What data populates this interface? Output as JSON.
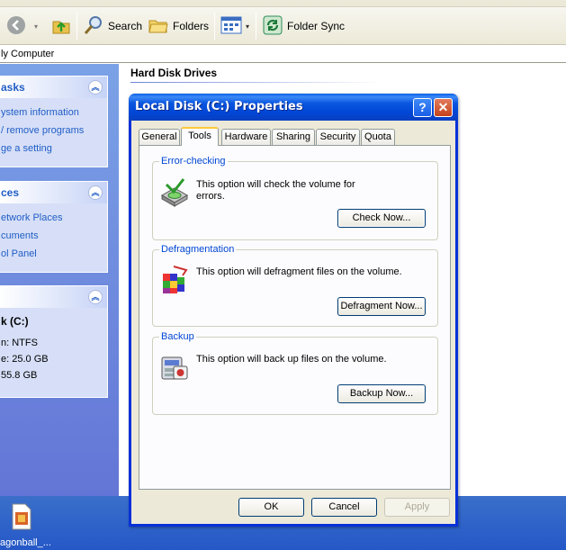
{
  "explorer": {
    "toolbar": {
      "search_label": "Search",
      "folders_label": "Folders",
      "folder_sync_label": "Folder Sync"
    },
    "address": "ly Computer",
    "tasks_box": {
      "title": "asks",
      "links": [
        "ystem information",
        "/ remove programs",
        "ge a setting"
      ]
    },
    "places_box": {
      "title": "ces",
      "links": [
        "etwork Places",
        "cuments",
        "ol Panel"
      ]
    },
    "details_box": {
      "drive": "k (C:)",
      "lines": [
        "n: NTFS",
        "e: 25.0 GB",
        "55.8 GB"
      ]
    },
    "main": {
      "section_title": "Hard Disk Drives"
    },
    "desktop_icon_label": "agonball_..."
  },
  "dialog": {
    "title": "Local Disk (C:) Properties",
    "help_glyph": "?",
    "close_glyph": "✕",
    "tabs": [
      {
        "label": "General",
        "active": false
      },
      {
        "label": "Tools",
        "active": true
      },
      {
        "label": "Hardware",
        "active": false
      },
      {
        "label": "Sharing",
        "active": false
      },
      {
        "label": "Security",
        "active": false
      },
      {
        "label": "Quota",
        "active": false
      }
    ],
    "groups": {
      "error_checking": {
        "label": "Error-checking",
        "text": "This option will check the volume for errors.",
        "button": "Check Now..."
      },
      "defragmentation": {
        "label": "Defragmentation",
        "text": "This option will defragment files on the volume.",
        "button": "Defragment Now..."
      },
      "backup": {
        "label": "Backup",
        "text": "This option will back up files on the volume.",
        "button": "Backup Now..."
      }
    },
    "buttons": {
      "ok": "OK",
      "cancel": "Cancel",
      "apply": "Apply"
    }
  },
  "colors": {
    "title_blue": "#0046d6",
    "group_label_blue": "#0046d5",
    "link_blue": "#215dc6",
    "left_pane": "#6375d6"
  },
  "icons": [
    "back-icon",
    "up-folder-icon",
    "search-icon",
    "folders-icon",
    "views-icon",
    "folder-sync-icon",
    "chevron-up-icon",
    "error-check-icon",
    "defrag-icon",
    "backup-icon",
    "help-icon",
    "close-icon"
  ]
}
